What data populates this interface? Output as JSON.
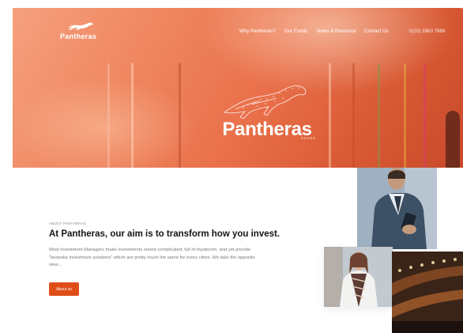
{
  "header": {
    "logo_text": "Pantheras",
    "nav": [
      {
        "label": "Why Pantheras?"
      },
      {
        "label": "Our Funds"
      },
      {
        "label": "News & Resource"
      },
      {
        "label": "Contact Us"
      }
    ],
    "phone": "0(20) 3963 7686"
  },
  "hero": {
    "brand_name": "Pantheras",
    "brand_sub": "HOUSE"
  },
  "about": {
    "eyebrow": "ABOUT PANTHERAS",
    "heading": "At Pantheras, our aim is to transform how you invest.",
    "body": "Most Investment Managers make investments sound complicated, full of mysticism, and yet provide \"bespoke investment solutions\" which are pretty much the same for every client. We take the opposite view...",
    "button": "About us"
  },
  "colors": {
    "accent": "#de4d18",
    "hero_orange": "#e9704a"
  }
}
